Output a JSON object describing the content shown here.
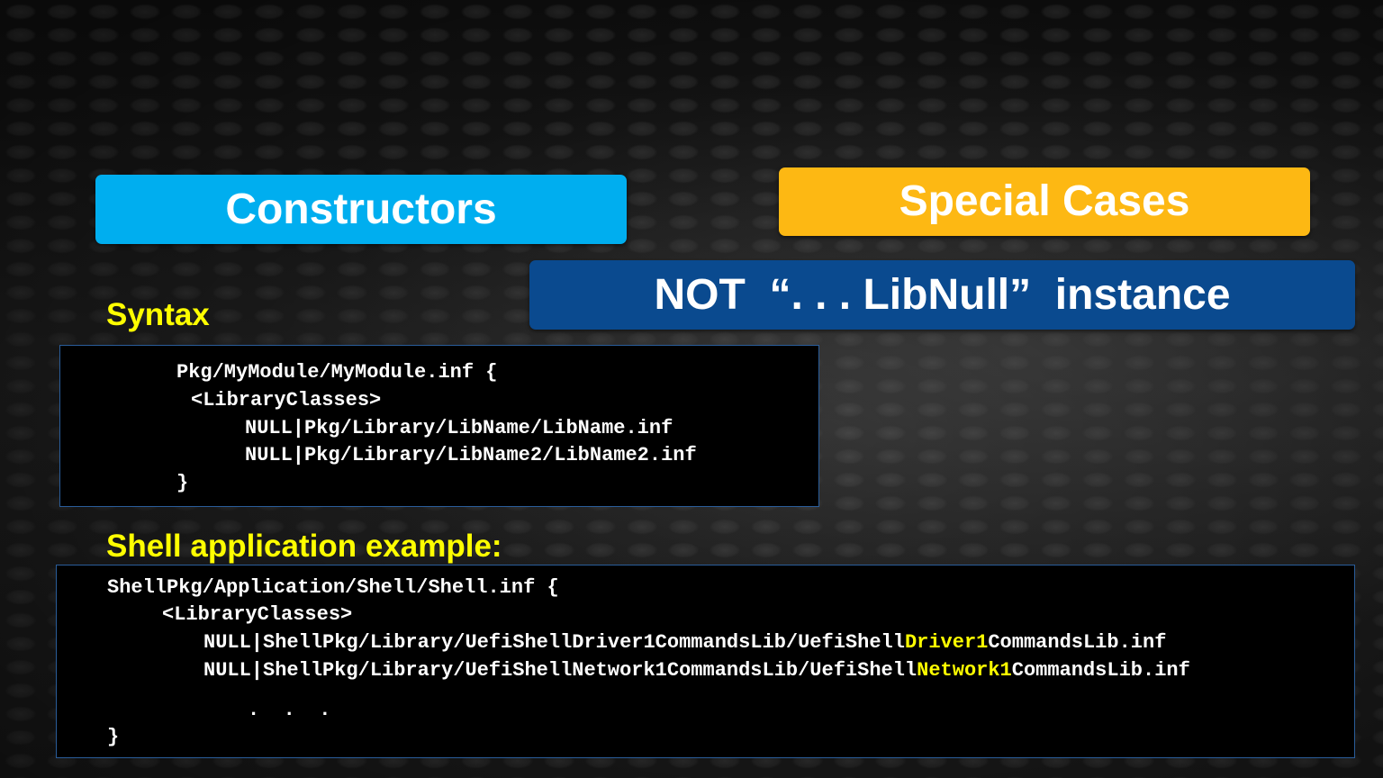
{
  "headers": {
    "constructors": "Constructors",
    "special_cases": "Special Cases",
    "not_libnull": "NOT  “. . . LibNull”  instance"
  },
  "sections": {
    "syntax_heading": "Syntax",
    "shell_heading": "Shell application example:"
  },
  "syntax_code": {
    "line1": "Pkg/MyModule/MyModule.inf {",
    "line2": "<LibraryClasses>",
    "line3": "NULL|Pkg/Library/LibName/LibName.inf",
    "line4": "NULL|Pkg/Library/LibName2/LibName2.inf",
    "line5": "}"
  },
  "shell_code": {
    "line1": "ShellPkg/Application/Shell/Shell.inf {",
    "line2": "<LibraryClasses>",
    "line3_prefix": "NULL|ShellPkg/Library/UefiShellDriver1CommandsLib/UefiShell",
    "line3_highlight": "Driver1",
    "line3_suffix": "CommandsLib.inf",
    "line4_prefix": "NULL|ShellPkg/Library/UefiShellNetwork1CommandsLib/UefiShell",
    "line4_highlight": "Network1",
    "line4_suffix": "CommandsLib.inf",
    "ellipsis": ".  .  .",
    "closing": "}"
  },
  "colors": {
    "constructors_bg": "#00aeef",
    "special_cases_bg": "#fdb813",
    "not_libnull_bg": "#0a4a8f",
    "heading_text": "#ffff00",
    "code_highlight": "#ffff00"
  }
}
